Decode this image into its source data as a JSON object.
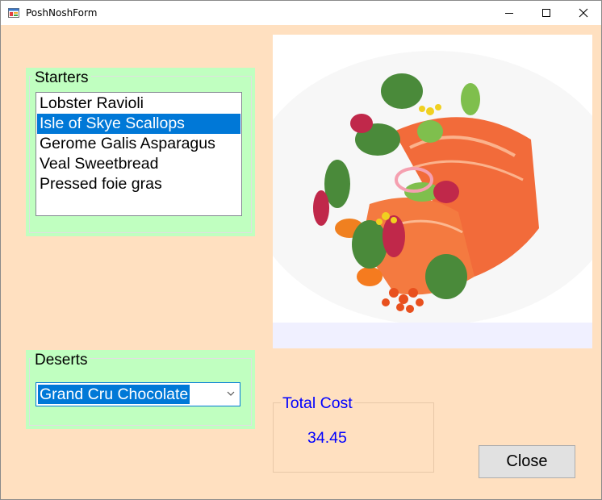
{
  "window": {
    "title": "PoshNoshForm",
    "icon": "windows-form-app-icon",
    "controls": [
      "minimize-icon",
      "maximize-icon",
      "close-icon"
    ]
  },
  "starters": {
    "title": "Starters",
    "items": [
      {
        "label": "Lobster Ravioli",
        "selected": false
      },
      {
        "label": "Isle of Skye Scallops",
        "selected": true
      },
      {
        "label": "Gerome Galis Asparagus",
        "selected": false
      },
      {
        "label": "Veal Sweetbread",
        "selected": false
      },
      {
        "label": "Pressed foie gras",
        "selected": false
      }
    ]
  },
  "deserts": {
    "title": "Deserts",
    "selected": "Grand Cru Chocolate",
    "icon": "chevron-down-icon"
  },
  "picture": {
    "subject": "plated salmon dish with microgreens and salmon roe"
  },
  "total": {
    "label": "Total Cost",
    "value": "34.45"
  },
  "close_button": {
    "label": "Close"
  },
  "colors": {
    "form_background": "#ffe0c0",
    "group_background": "#c0ffc0",
    "selection": "#0078d7",
    "total_text": "#0000ff",
    "picture_background": "#f0f0ff"
  }
}
